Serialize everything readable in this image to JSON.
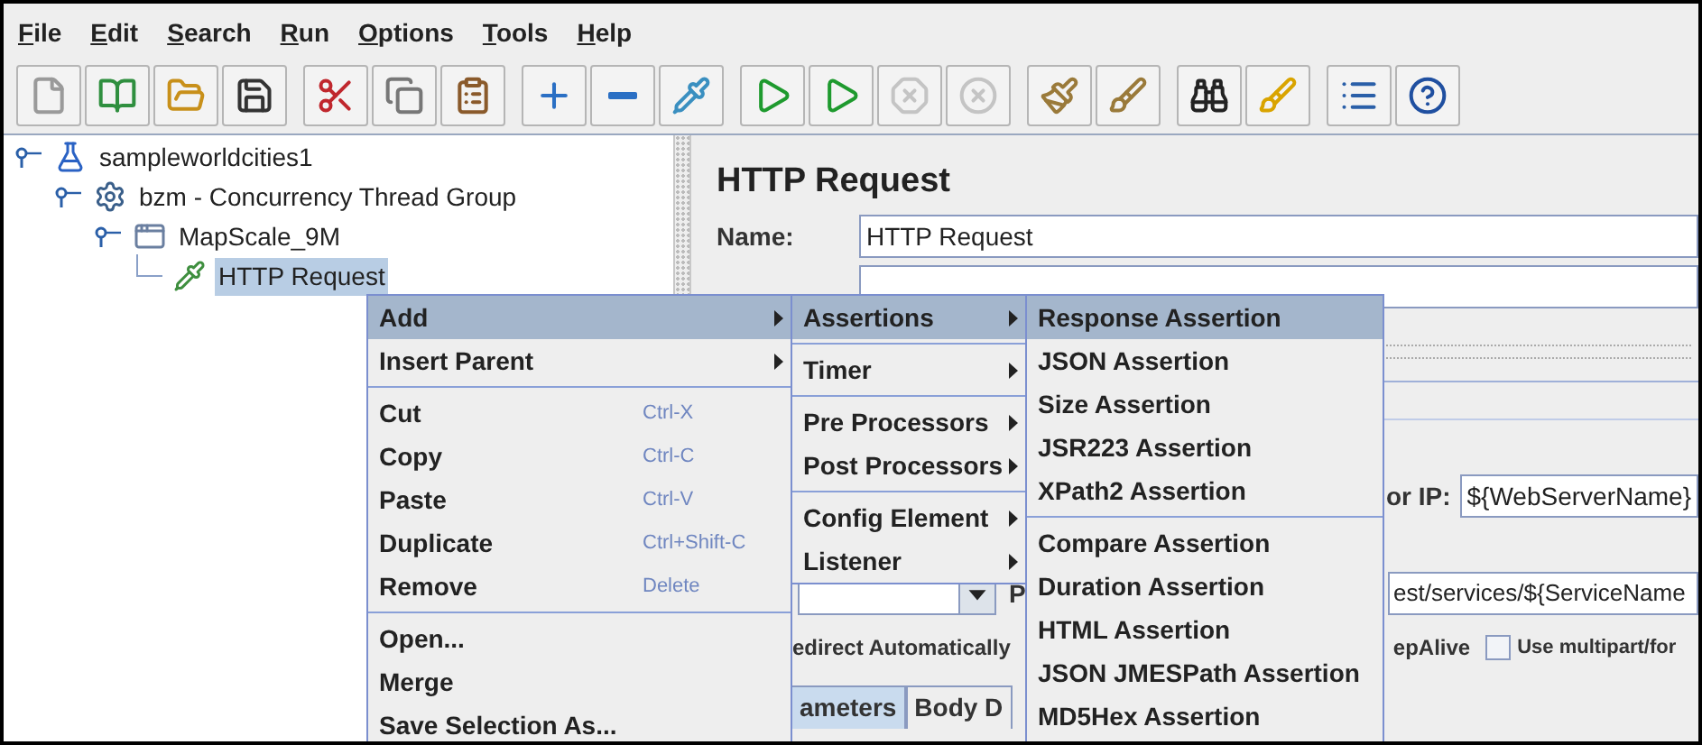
{
  "menu_bar": [
    {
      "label": "File"
    },
    {
      "label": "Edit"
    },
    {
      "label": "Search"
    },
    {
      "label": "Run"
    },
    {
      "label": "Options"
    },
    {
      "label": "Tools"
    },
    {
      "label": "Help"
    }
  ],
  "toolbar": [
    [
      {
        "kind": "new",
        "disabled": false
      },
      {
        "kind": "templates",
        "disabled": false
      },
      {
        "kind": "open",
        "disabled": false
      },
      {
        "kind": "save",
        "disabled": false
      }
    ],
    [
      {
        "kind": "cut",
        "disabled": false
      },
      {
        "kind": "copy",
        "disabled": false
      },
      {
        "kind": "paste",
        "disabled": false
      }
    ],
    [
      {
        "kind": "expand",
        "disabled": false
      },
      {
        "kind": "collapse",
        "disabled": false
      },
      {
        "kind": "toggle",
        "disabled": false
      }
    ],
    [
      {
        "kind": "start",
        "disabled": false
      },
      {
        "kind": "start_no_pauses",
        "disabled": false
      },
      {
        "kind": "stop",
        "disabled": true
      },
      {
        "kind": "shutdown",
        "disabled": true
      }
    ],
    [
      {
        "kind": "clear",
        "disabled": false
      },
      {
        "kind": "clear_all",
        "disabled": false
      }
    ],
    [
      {
        "kind": "search",
        "disabled": false
      },
      {
        "kind": "reset_search",
        "disabled": false
      }
    ],
    [
      {
        "kind": "function_helper",
        "disabled": false
      },
      {
        "kind": "help",
        "disabled": false
      }
    ]
  ],
  "tree": [
    {
      "label": "sampleworldcities1",
      "kind": "test_plan",
      "selected": false,
      "expanded": true,
      "children": [
        {
          "label": "bzm - Concurrency Thread Group",
          "kind": "thread_group",
          "selected": false,
          "expanded": true,
          "children": [
            {
              "label": "MapScale_9M",
              "kind": "controller",
              "selected": false,
              "expanded": true,
              "children": [
                {
                  "label": "HTTP Request",
                  "kind": "sampler",
                  "selected": true
                }
              ]
            }
          ]
        }
      ]
    }
  ],
  "editor": {
    "title": "HTTP Request",
    "name_label": "Name:",
    "name_value": "HTTP Request",
    "server_label": "or IP:",
    "server_value": "${WebServerName}",
    "path_label": "P",
    "path_value": "est/services/${ServiceName",
    "options": [
      {
        "label": "edirect Automatically",
        "kind": "text"
      },
      {
        "label": "epAlive",
        "kind": "text"
      },
      {
        "label": "Use multipart/for",
        "kind": "checkbox",
        "checked": false
      }
    ],
    "tabs": [
      {
        "label": "ameters",
        "selected": true
      },
      {
        "label": "Body D",
        "selected": false
      }
    ]
  },
  "context_menu": [
    {
      "kind": "item",
      "label": "Add",
      "submenu": true,
      "selected": true
    },
    {
      "kind": "item",
      "label": "Insert Parent",
      "submenu": true,
      "selected": false
    },
    {
      "kind": "separator"
    },
    {
      "kind": "item",
      "label": "Cut",
      "shortcut": "Ctrl-X",
      "submenu": false,
      "selected": false
    },
    {
      "kind": "item",
      "label": "Copy",
      "shortcut": "Ctrl-C",
      "submenu": false,
      "selected": false
    },
    {
      "kind": "item",
      "label": "Paste",
      "shortcut": "Ctrl-V",
      "submenu": false,
      "selected": false
    },
    {
      "kind": "item",
      "label": "Duplicate",
      "shortcut": "Ctrl+Shift-C",
      "submenu": false,
      "selected": false
    },
    {
      "kind": "item",
      "label": "Remove",
      "shortcut": "Delete",
      "submenu": false,
      "selected": false
    },
    {
      "kind": "separator"
    },
    {
      "kind": "item",
      "label": "Open...",
      "submenu": false,
      "selected": false
    },
    {
      "kind": "item",
      "label": "Merge",
      "submenu": false,
      "selected": false
    },
    {
      "kind": "item",
      "label": "Save Selection As...",
      "submenu": false,
      "selected": false
    }
  ],
  "add_submenu": [
    {
      "kind": "item",
      "label": "Assertions",
      "submenu": true,
      "selected": true
    },
    {
      "kind": "separator"
    },
    {
      "kind": "item",
      "label": "Timer",
      "submenu": true,
      "selected": false
    },
    {
      "kind": "separator"
    },
    {
      "kind": "item",
      "label": "Pre Processors",
      "submenu": true,
      "selected": false
    },
    {
      "kind": "item",
      "label": "Post Processors",
      "submenu": true,
      "selected": false
    },
    {
      "kind": "separator"
    },
    {
      "kind": "item",
      "label": "Config Element",
      "submenu": true,
      "selected": false
    },
    {
      "kind": "item",
      "label": "Listener",
      "submenu": true,
      "selected": false
    }
  ],
  "assertions_submenu": [
    {
      "kind": "item",
      "label": "Response Assertion",
      "submenu": false,
      "selected": true
    },
    {
      "kind": "item",
      "label": "JSON Assertion",
      "submenu": false,
      "selected": false
    },
    {
      "kind": "item",
      "label": "Size Assertion",
      "submenu": false,
      "selected": false
    },
    {
      "kind": "item",
      "label": "JSR223 Assertion",
      "submenu": false,
      "selected": false
    },
    {
      "kind": "item",
      "label": "XPath2 Assertion",
      "submenu": false,
      "selected": false
    },
    {
      "kind": "separator"
    },
    {
      "kind": "item",
      "label": "Compare Assertion",
      "submenu": false,
      "selected": false
    },
    {
      "kind": "item",
      "label": "Duration Assertion",
      "submenu": false,
      "selected": false
    },
    {
      "kind": "item",
      "label": "HTML Assertion",
      "submenu": false,
      "selected": false
    },
    {
      "kind": "item",
      "label": "JSON JMESPath Assertion",
      "submenu": false,
      "selected": false
    },
    {
      "kind": "item",
      "label": "MD5Hex Assertion",
      "submenu": false,
      "selected": false
    }
  ]
}
